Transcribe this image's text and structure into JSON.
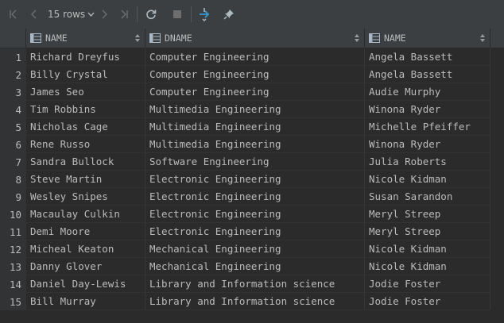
{
  "toolbar": {
    "rows_label": "15 rows",
    "accent": "#3592c4"
  },
  "columns": [
    {
      "label": "NAME",
      "icon": "table-column-icon"
    },
    {
      "label": "DNAME",
      "icon": "table-column-icon"
    },
    {
      "label": "NAME",
      "icon": "table-column-icon"
    }
  ],
  "rows": [
    {
      "n": "1",
      "a": "Richard Dreyfus",
      "b": "Computer Engineering",
      "c": "Angela Bassett"
    },
    {
      "n": "2",
      "a": "Billy Crystal",
      "b": "Computer Engineering",
      "c": "Angela Bassett"
    },
    {
      "n": "3",
      "a": "James Seo",
      "b": "Computer Engineering",
      "c": "Audie Murphy"
    },
    {
      "n": "4",
      "a": "Tim Robbins",
      "b": "Multimedia Engineering",
      "c": "Winona Ryder"
    },
    {
      "n": "5",
      "a": "Nicholas Cage",
      "b": "Multimedia Engineering",
      "c": "Michelle Pfeiffer"
    },
    {
      "n": "6",
      "a": "Rene Russo",
      "b": "Multimedia Engineering",
      "c": "Winona Ryder"
    },
    {
      "n": "7",
      "a": "Sandra Bullock",
      "b": "Software Engineering",
      "c": "Julia Roberts"
    },
    {
      "n": "8",
      "a": "Steve Martin",
      "b": "Electronic Engineering",
      "c": "Nicole Kidman"
    },
    {
      "n": "9",
      "a": "Wesley Snipes",
      "b": "Electronic Engineering",
      "c": "Susan Sarandon"
    },
    {
      "n": "10",
      "a": "Macaulay Culkin",
      "b": "Electronic Engineering",
      "c": "Meryl Streep"
    },
    {
      "n": "11",
      "a": "Demi Moore",
      "b": "Electronic Engineering",
      "c": "Meryl Streep"
    },
    {
      "n": "12",
      "a": "Micheal Keaton",
      "b": "Mechanical Engineering",
      "c": "Nicole Kidman"
    },
    {
      "n": "13",
      "a": "Danny Glover",
      "b": "Mechanical Engineering",
      "c": "Nicole Kidman"
    },
    {
      "n": "14",
      "a": "Daniel Day-Lewis",
      "b": "Library and Information science",
      "c": "Jodie Foster"
    },
    {
      "n": "15",
      "a": "Bill Murray",
      "b": "Library and Information science",
      "c": "Jodie Foster"
    }
  ]
}
